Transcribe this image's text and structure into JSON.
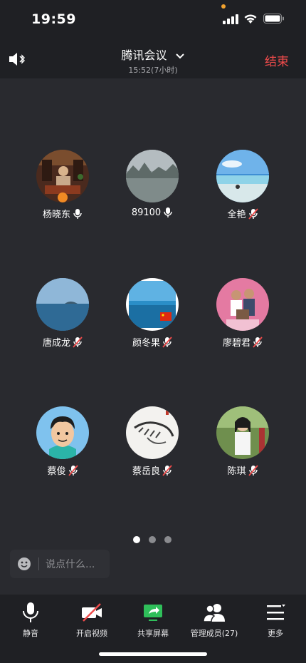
{
  "status_bar": {
    "time": "19:59"
  },
  "header": {
    "title": "腾讯会议",
    "subtitle": "15:52(7小时)",
    "end_label": "结束"
  },
  "participants": [
    {
      "name": "杨晓东",
      "muted": false,
      "host": true
    },
    {
      "name": "89100",
      "muted": false,
      "host": false
    },
    {
      "name": "全艳",
      "muted": true,
      "host": false
    },
    {
      "name": "唐成龙",
      "muted": true,
      "host": false
    },
    {
      "name": "颜冬果",
      "muted": true,
      "host": false
    },
    {
      "name": "廖碧君",
      "muted": true,
      "host": false
    },
    {
      "name": "蔡俊",
      "muted": true,
      "host": false
    },
    {
      "name": "蔡岳良",
      "muted": true,
      "host": false
    },
    {
      "name": "陈琪",
      "muted": true,
      "host": false
    }
  ],
  "pager": {
    "count": 3,
    "active": 1
  },
  "chat": {
    "placeholder": "说点什么..."
  },
  "toolbar": {
    "mute_label": "静音",
    "video_label": "开启视频",
    "share_label": "共享屏幕",
    "members_label": "管理成员(27)",
    "more_label": "更多"
  },
  "colors": {
    "end": "#ef4b4b",
    "share_icon": "#2fbf5a",
    "host_badge": "#f08a24",
    "background": "#292a2f"
  }
}
